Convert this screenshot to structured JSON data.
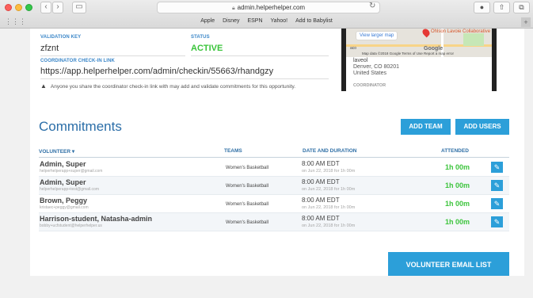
{
  "browser": {
    "url": "admin.helperhelper.com",
    "bookmarks": [
      "Apple",
      "Disney",
      "ESPN",
      "Yahoo!",
      "Add to Babylist"
    ]
  },
  "checkin": {
    "validation_key_label": "VALIDATION KEY",
    "validation_key": "zfznt",
    "status_label": "STATUS",
    "status": "ACTIVE",
    "link_label": "COORDINATOR CHECK-IN LINK",
    "link": "https://app.helperhelper.com/admin/checkin/55663/rhandgzy",
    "warning": "Anyone you share the coordinator check-in link with may add and validate commitments for this opportunity."
  },
  "map": {
    "view_larger": "View larger map",
    "place": "Ohlson Lavoie Collaborative",
    "google": "Google",
    "map_data": "Map data ©2018 Google   Terms of Use   Report a map error",
    "small": "aco",
    "address_line1": "laveol",
    "address_line2": "Denver, CO 80201",
    "address_line3": "United States",
    "coordinator_label": "COORDINATOR"
  },
  "commitments": {
    "title": "Commitments",
    "add_team": "ADD TEAM",
    "add_users": "ADD USERS",
    "columns": {
      "volunteer": "VOLUNTEER ▾",
      "teams": "TEAMS",
      "date": "DATE AND DURATION",
      "attended": "ATTENDED"
    },
    "rows": [
      {
        "name": "Admin, Super",
        "email": "helperhelperapp+super@gmail.com",
        "team": "Women's Basketball",
        "time": "8:00 AM EDT",
        "duration": "on Jun 22, 2018 for 1h 00m",
        "attended": "1h 00m"
      },
      {
        "name": "Admin, Super",
        "email": "helperhelperapp+test@gmail.com",
        "team": "Women's Basketball",
        "time": "8:00 AM EDT",
        "duration": "on Jun 22, 2018 for 1h 00m",
        "attended": "1h 00m"
      },
      {
        "name": "Brown, Peggy",
        "email": "kristaec+peggy@gmail.com",
        "team": "Women's Basketball",
        "time": "8:00 AM EDT",
        "duration": "on Jun 22, 2018 for 1h 00m",
        "attended": "1h 00m"
      },
      {
        "name": "Harrison-student, Natasha-admin",
        "email": "bobby+ucfstudent@helperhelper.us",
        "team": "Women's Basketball",
        "time": "8:00 AM EDT",
        "duration": "on Jun 22, 2018 for 1h 00m",
        "attended": "1h 00m"
      }
    ],
    "email_list": "VOLUNTEER EMAIL LIST"
  }
}
